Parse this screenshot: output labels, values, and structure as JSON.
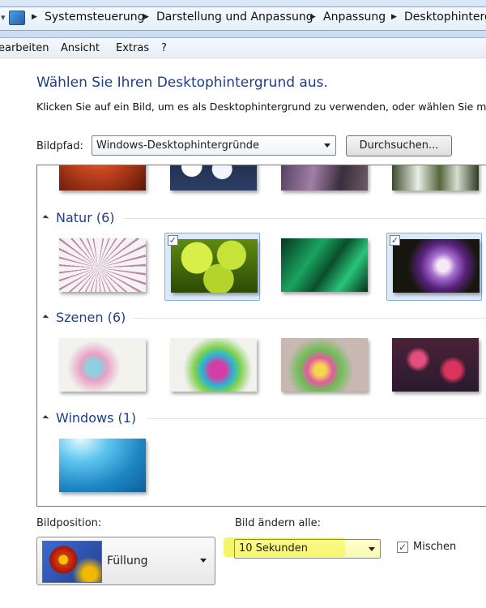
{
  "breadcrumb": [
    "Systemsteuerung",
    "Darstellung und Anpassung",
    "Anpassung",
    "Desktophintergr"
  ],
  "menu": [
    "earbeiten",
    "Ansicht",
    "Extras",
    "?"
  ],
  "heading": {
    "title": "Wählen Sie Ihren Desktophintergrund aus.",
    "instruction": "Klicken Sie auf ein Bild, um es als Desktophintergrund zu verwenden, oder wählen Sie m"
  },
  "picture_location": {
    "label": "Bildpfad:",
    "value": "Windows-Desktophintergründe",
    "browse_label": "Durchsuchen..."
  },
  "gallery": {
    "groups": [
      {
        "title": "Natur (6)"
      },
      {
        "title": "Szenen (6)"
      },
      {
        "title": "Windows (1)"
      }
    ],
    "checkbox_glyph": "✓"
  },
  "picture_position": {
    "label": "Bildposition:",
    "value": "Füllung"
  },
  "change_interval": {
    "label": "Bild ändern alle:",
    "value": "10 Sekunden"
  },
  "shuffle": {
    "label": "Mischen",
    "checked": true,
    "glyph": "✓"
  },
  "colors": {
    "accent_title": "#1e3e87",
    "highlight": "#f5f56b"
  }
}
